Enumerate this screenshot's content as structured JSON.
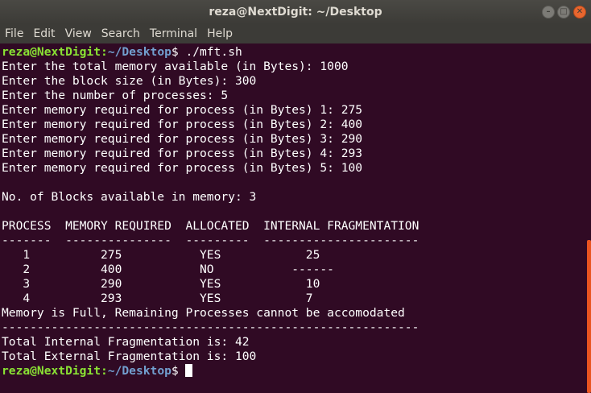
{
  "window": {
    "title": "reza@NextDigit: ~/Desktop",
    "controls": {
      "minimize_icon": "–",
      "maximize_icon": "□",
      "close_icon": "✕"
    }
  },
  "menubar": [
    "File",
    "Edit",
    "View",
    "Search",
    "Terminal",
    "Help"
  ],
  "prompt": {
    "user_host": "reza@NextDigit",
    "path_sep": ":",
    "path": "~/Desktop",
    "symbol": "$"
  },
  "session": {
    "command": " ./mft.sh",
    "inputs": [
      "Enter the total memory available (in Bytes): 1000",
      "Enter the block size (in Bytes): 300",
      "Enter the number of processes: 5",
      "Enter memory required for process (in Bytes) 1: 275",
      "Enter memory required for process (in Bytes) 2: 400",
      "Enter memory required for process (in Bytes) 3: 290",
      "Enter memory required for process (in Bytes) 4: 293",
      "Enter memory required for process (in Bytes) 5: 100"
    ],
    "blocks_line": "No. of Blocks available in memory: 3",
    "table_header": "PROCESS  MEMORY REQUIRED  ALLOCATED  INTERNAL FRAGMENTATION",
    "table_rule": "-------  ---------------  ---------  ----------------------",
    "table_rows": [
      "   1          275           YES            25",
      "   2          400           NO           ------",
      "   3          290           YES            10",
      "   4          293           YES            7"
    ],
    "full_msg": "Memory is Full, Remaining Processes cannot be accomodated",
    "separator": "-----------------------------------------------------------",
    "internal_frag": "Total Internal Fragmentation is: 42",
    "external_frag": "Total External Fragmentation is: 100"
  },
  "colors": {
    "background": "#300a24",
    "prompt_user": "#8ae234",
    "prompt_path": "#729fcf",
    "scroll_thumb": "#e95420"
  }
}
